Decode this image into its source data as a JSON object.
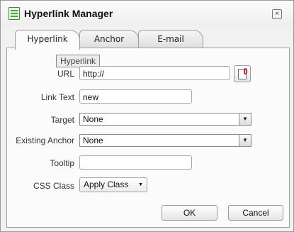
{
  "window": {
    "title": "Hyperlink Manager",
    "close_glyph": "×"
  },
  "tabs": [
    {
      "label": "Hyperlink",
      "active": true
    },
    {
      "label": "Anchor",
      "active": false
    },
    {
      "label": "E-mail",
      "active": false
    }
  ],
  "tooltip": {
    "text": "Hyperlink"
  },
  "form": {
    "url": {
      "label": "URL",
      "value": "http://"
    },
    "link_text": {
      "label": "Link Text",
      "value": "new"
    },
    "target": {
      "label": "Target",
      "selected": "None"
    },
    "existing_anchor": {
      "label": "Existing Anchor",
      "selected": "None"
    },
    "tooltip_field": {
      "label": "Tooltip",
      "value": ""
    },
    "css_class": {
      "label": "CSS Class",
      "selected": "Apply Class"
    }
  },
  "buttons": {
    "ok": "OK",
    "cancel": "Cancel"
  },
  "icons": {
    "app": "hyperlink-manager-icon",
    "browse": "document-link-icon",
    "dropdown": "▼"
  }
}
